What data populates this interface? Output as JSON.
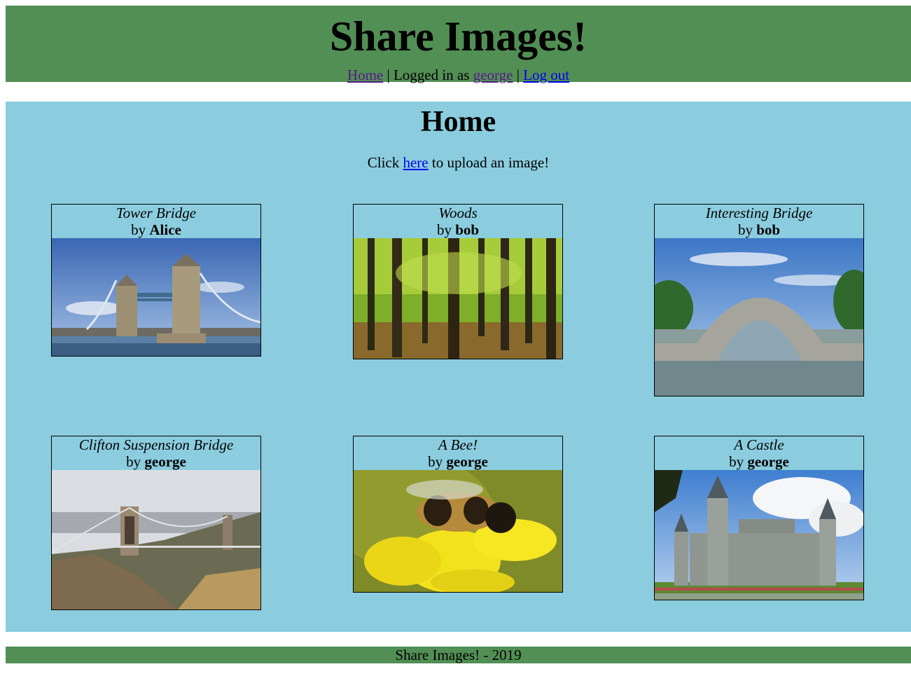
{
  "header": {
    "title": "Share Images!",
    "nav": {
      "home_label": "Home",
      "sep1": " | ",
      "logged_in_text": "Logged in as ",
      "username": "george",
      "sep2": " | ",
      "logout_label": "Log out"
    }
  },
  "main": {
    "heading": "Home",
    "upload_prefix": "Click ",
    "upload_link": "here",
    "upload_suffix": " to upload an image!"
  },
  "images": [
    {
      "title": "Tower Bridge",
      "by_prefix": "by ",
      "author": "Alice"
    },
    {
      "title": "Woods",
      "by_prefix": "by ",
      "author": "bob"
    },
    {
      "title": "Interesting Bridge",
      "by_prefix": "by ",
      "author": "bob"
    },
    {
      "title": "Clifton Suspension Bridge",
      "by_prefix": "by ",
      "author": "george"
    },
    {
      "title": "A Bee!",
      "by_prefix": "by ",
      "author": "george"
    },
    {
      "title": "A Castle",
      "by_prefix": "by ",
      "author": "george"
    }
  ],
  "footer": {
    "text": "Share Images! - 2019"
  },
  "colors": {
    "header_bg": "#528f55",
    "main_bg": "#8bcddf",
    "link": "#0000ee",
    "visited_link": "#551a8b"
  }
}
